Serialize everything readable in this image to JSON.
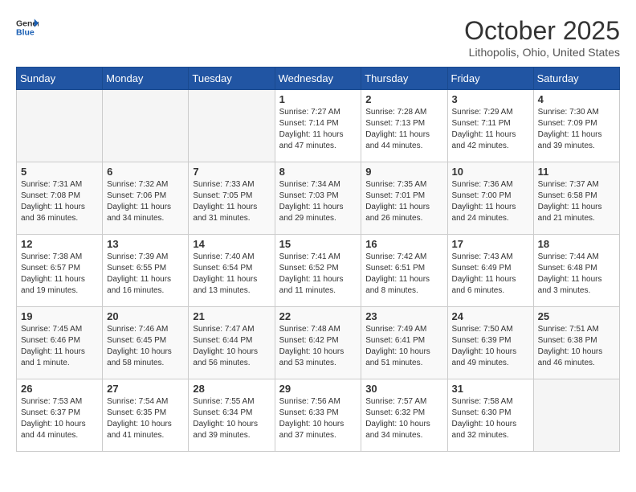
{
  "header": {
    "logo_line1": "General",
    "logo_line2": "Blue",
    "month": "October 2025",
    "location": "Lithopolis, Ohio, United States"
  },
  "weekdays": [
    "Sunday",
    "Monday",
    "Tuesday",
    "Wednesday",
    "Thursday",
    "Friday",
    "Saturday"
  ],
  "weeks": [
    [
      {
        "day": "",
        "content": ""
      },
      {
        "day": "",
        "content": ""
      },
      {
        "day": "",
        "content": ""
      },
      {
        "day": "1",
        "content": "Sunrise: 7:27 AM\nSunset: 7:14 PM\nDaylight: 11 hours\nand 47 minutes."
      },
      {
        "day": "2",
        "content": "Sunrise: 7:28 AM\nSunset: 7:13 PM\nDaylight: 11 hours\nand 44 minutes."
      },
      {
        "day": "3",
        "content": "Sunrise: 7:29 AM\nSunset: 7:11 PM\nDaylight: 11 hours\nand 42 minutes."
      },
      {
        "day": "4",
        "content": "Sunrise: 7:30 AM\nSunset: 7:09 PM\nDaylight: 11 hours\nand 39 minutes."
      }
    ],
    [
      {
        "day": "5",
        "content": "Sunrise: 7:31 AM\nSunset: 7:08 PM\nDaylight: 11 hours\nand 36 minutes."
      },
      {
        "day": "6",
        "content": "Sunrise: 7:32 AM\nSunset: 7:06 PM\nDaylight: 11 hours\nand 34 minutes."
      },
      {
        "day": "7",
        "content": "Sunrise: 7:33 AM\nSunset: 7:05 PM\nDaylight: 11 hours\nand 31 minutes."
      },
      {
        "day": "8",
        "content": "Sunrise: 7:34 AM\nSunset: 7:03 PM\nDaylight: 11 hours\nand 29 minutes."
      },
      {
        "day": "9",
        "content": "Sunrise: 7:35 AM\nSunset: 7:01 PM\nDaylight: 11 hours\nand 26 minutes."
      },
      {
        "day": "10",
        "content": "Sunrise: 7:36 AM\nSunset: 7:00 PM\nDaylight: 11 hours\nand 24 minutes."
      },
      {
        "day": "11",
        "content": "Sunrise: 7:37 AM\nSunset: 6:58 PM\nDaylight: 11 hours\nand 21 minutes."
      }
    ],
    [
      {
        "day": "12",
        "content": "Sunrise: 7:38 AM\nSunset: 6:57 PM\nDaylight: 11 hours\nand 19 minutes."
      },
      {
        "day": "13",
        "content": "Sunrise: 7:39 AM\nSunset: 6:55 PM\nDaylight: 11 hours\nand 16 minutes."
      },
      {
        "day": "14",
        "content": "Sunrise: 7:40 AM\nSunset: 6:54 PM\nDaylight: 11 hours\nand 13 minutes."
      },
      {
        "day": "15",
        "content": "Sunrise: 7:41 AM\nSunset: 6:52 PM\nDaylight: 11 hours\nand 11 minutes."
      },
      {
        "day": "16",
        "content": "Sunrise: 7:42 AM\nSunset: 6:51 PM\nDaylight: 11 hours\nand 8 minutes."
      },
      {
        "day": "17",
        "content": "Sunrise: 7:43 AM\nSunset: 6:49 PM\nDaylight: 11 hours\nand 6 minutes."
      },
      {
        "day": "18",
        "content": "Sunrise: 7:44 AM\nSunset: 6:48 PM\nDaylight: 11 hours\nand 3 minutes."
      }
    ],
    [
      {
        "day": "19",
        "content": "Sunrise: 7:45 AM\nSunset: 6:46 PM\nDaylight: 11 hours\nand 1 minute."
      },
      {
        "day": "20",
        "content": "Sunrise: 7:46 AM\nSunset: 6:45 PM\nDaylight: 10 hours\nand 58 minutes."
      },
      {
        "day": "21",
        "content": "Sunrise: 7:47 AM\nSunset: 6:44 PM\nDaylight: 10 hours\nand 56 minutes."
      },
      {
        "day": "22",
        "content": "Sunrise: 7:48 AM\nSunset: 6:42 PM\nDaylight: 10 hours\nand 53 minutes."
      },
      {
        "day": "23",
        "content": "Sunrise: 7:49 AM\nSunset: 6:41 PM\nDaylight: 10 hours\nand 51 minutes."
      },
      {
        "day": "24",
        "content": "Sunrise: 7:50 AM\nSunset: 6:39 PM\nDaylight: 10 hours\nand 49 minutes."
      },
      {
        "day": "25",
        "content": "Sunrise: 7:51 AM\nSunset: 6:38 PM\nDaylight: 10 hours\nand 46 minutes."
      }
    ],
    [
      {
        "day": "26",
        "content": "Sunrise: 7:53 AM\nSunset: 6:37 PM\nDaylight: 10 hours\nand 44 minutes."
      },
      {
        "day": "27",
        "content": "Sunrise: 7:54 AM\nSunset: 6:35 PM\nDaylight: 10 hours\nand 41 minutes."
      },
      {
        "day": "28",
        "content": "Sunrise: 7:55 AM\nSunset: 6:34 PM\nDaylight: 10 hours\nand 39 minutes."
      },
      {
        "day": "29",
        "content": "Sunrise: 7:56 AM\nSunset: 6:33 PM\nDaylight: 10 hours\nand 37 minutes."
      },
      {
        "day": "30",
        "content": "Sunrise: 7:57 AM\nSunset: 6:32 PM\nDaylight: 10 hours\nand 34 minutes."
      },
      {
        "day": "31",
        "content": "Sunrise: 7:58 AM\nSunset: 6:30 PM\nDaylight: 10 hours\nand 32 minutes."
      },
      {
        "day": "",
        "content": ""
      }
    ]
  ]
}
